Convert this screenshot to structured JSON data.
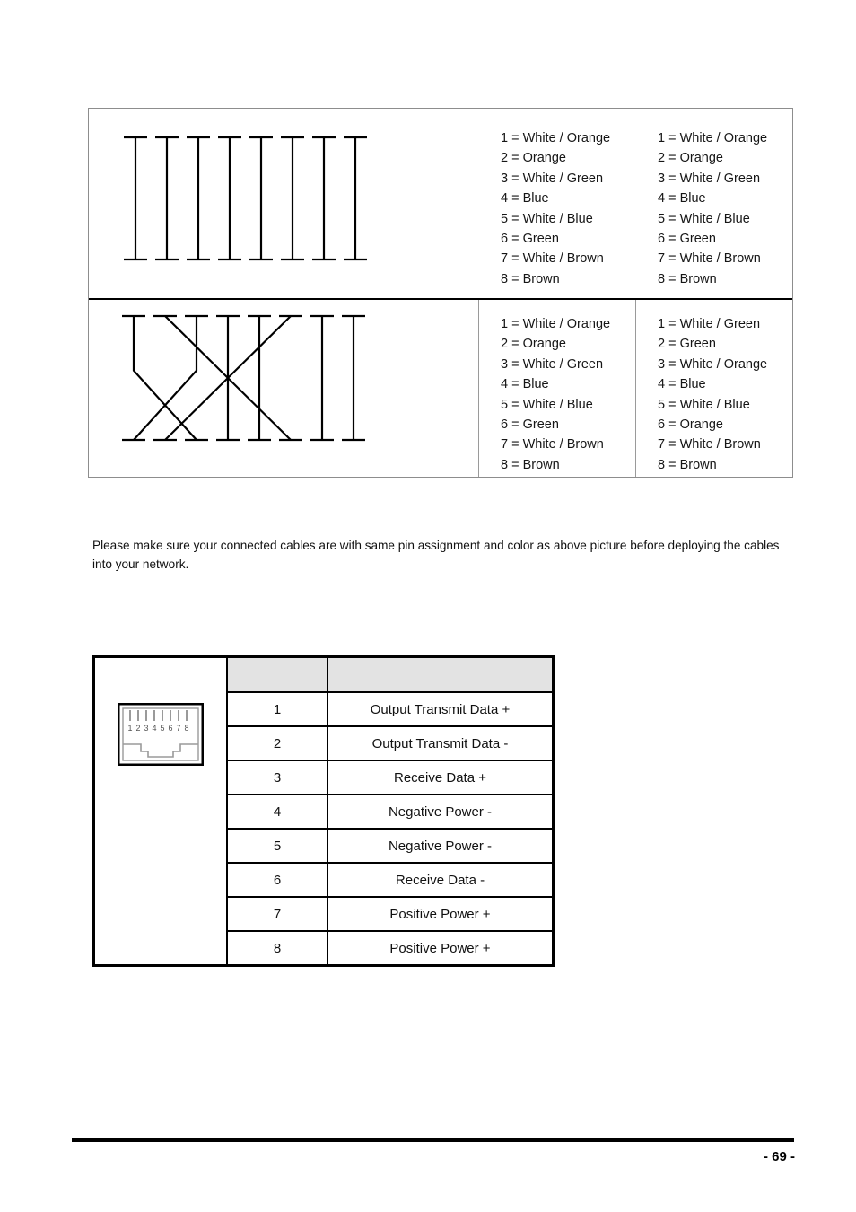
{
  "cable_diagrams": {
    "straight_through": {
      "diagram_name": "straight-through-cable-diagram",
      "connections": [
        {
          "from": 1,
          "to": 1
        },
        {
          "from": 2,
          "to": 2
        },
        {
          "from": 3,
          "to": 3
        },
        {
          "from": 4,
          "to": 4
        },
        {
          "from": 5,
          "to": 5
        },
        {
          "from": 6,
          "to": 6
        },
        {
          "from": 7,
          "to": 7
        },
        {
          "from": 8,
          "to": 8
        }
      ],
      "left_pins": [
        "1 = White / Orange",
        "2 = Orange",
        "3 = White / Green",
        "4 = Blue",
        "5 = White / Blue",
        "6 = Green",
        "7 = White / Brown",
        "8 = Brown"
      ],
      "right_pins": [
        "1 = White / Orange",
        "2 = Orange",
        "3 = White / Green",
        "4 = Blue",
        "5 = White / Blue",
        "6 = Green",
        "7 = White / Brown",
        "8 = Brown"
      ]
    },
    "crossover": {
      "diagram_name": "crossover-cable-diagram",
      "connections": [
        {
          "from": 1,
          "to": 3
        },
        {
          "from": 2,
          "to": 6
        },
        {
          "from": 3,
          "to": 1
        },
        {
          "from": 4,
          "to": 4
        },
        {
          "from": 5,
          "to": 5
        },
        {
          "from": 6,
          "to": 2
        },
        {
          "from": 7,
          "to": 7
        },
        {
          "from": 8,
          "to": 8
        }
      ],
      "left_pins": [
        "1 = White / Orange",
        "2 = Orange",
        "3 = White / Green",
        "4 = Blue",
        "5 = White / Blue",
        "6 = Green",
        "7 = White / Brown",
        "8 = Brown"
      ],
      "right_pins": [
        "1 = White / Green",
        "2 = Green",
        "3 = White / Orange",
        "4 = Blue",
        "5 = White / Blue",
        "6 = Orange",
        "7 = White / Brown",
        "8 = Brown"
      ]
    }
  },
  "note": {
    "text": "Please make sure your connected cables are with same pin assignment and color as above picture before deploying the cables into your network."
  },
  "pinout_table": {
    "jack_icon": {
      "name": "rj45-jack-icon",
      "pin_labels": [
        "1",
        "2",
        "3",
        "4",
        "5",
        "6",
        "7",
        "8"
      ]
    },
    "headers": [
      "",
      ""
    ],
    "rows": [
      {
        "pin": "1",
        "description": "Output Transmit Data +"
      },
      {
        "pin": "2",
        "description": "Output Transmit Data -"
      },
      {
        "pin": "3",
        "description": "Receive Data +"
      },
      {
        "pin": "4",
        "description": "Negative Power -"
      },
      {
        "pin": "5",
        "description": "Negative Power -"
      },
      {
        "pin": "6",
        "description": "Receive Data -"
      },
      {
        "pin": "7",
        "description": "Positive Power +"
      },
      {
        "pin": "8",
        "description": "Positive Power +"
      }
    ]
  },
  "footer": {
    "page_number": "- 69 -"
  }
}
